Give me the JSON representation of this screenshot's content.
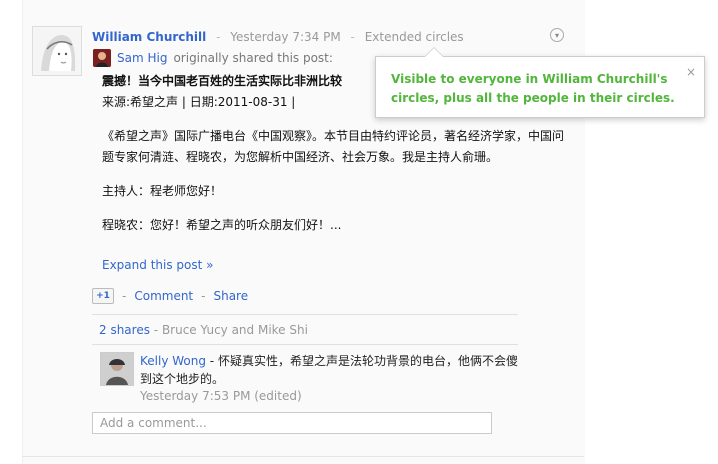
{
  "post": {
    "author": "William Churchill",
    "time": "Yesterday 7:34 PM",
    "visibility": "Extended circles",
    "shared_by": "Sam Hig",
    "shared_suffix": "originally shared this post:",
    "headline": "震撼！当今中国老百姓的生活实际比非洲比较",
    "source": "来源:希望之声 | 日期:2011-08-31 |",
    "paragraph1": "《希望之声》国际广播电台《中国观察》。本节目由特约评论员，著名经济学家，中国问题专家何清涟、程晓农，为您解析中国经济、社会万象。我是主持人俞珊。",
    "paragraph2": "主持人：程老师您好！",
    "paragraph3": "程晓农：您好！希望之声的听众朋友们好！...",
    "expand_link": "Expand this post »"
  },
  "actions": {
    "plus_one": "+1",
    "comment": "Comment",
    "share": "Share",
    "separator": "-"
  },
  "shares": {
    "count": "2 shares",
    "names": "- Bruce Yucy and Mike Shi"
  },
  "comment": {
    "author": "Kelly Wong",
    "text": "- 怀疑真实性，希望之声是法轮功背景的电台，他俩不会傻到这个地步的。",
    "time": "Yesterday 7:53 PM (edited)"
  },
  "add_comment": {
    "placeholder": "Add a comment..."
  },
  "tooltip": {
    "text": "Visible to everyone in William Churchill's circles, plus all the people in their circles.",
    "close": "×"
  }
}
